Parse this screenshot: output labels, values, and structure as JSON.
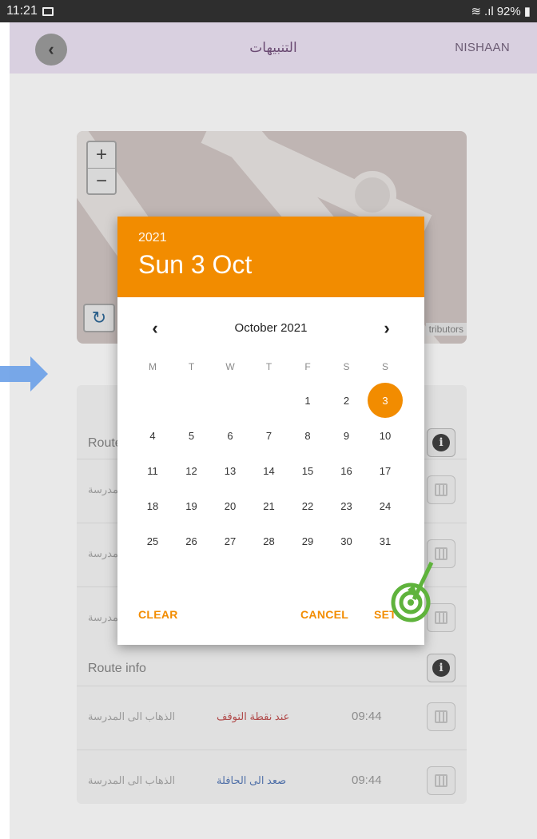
{
  "status_bar": {
    "time": "11:21",
    "battery": "92%"
  },
  "app": {
    "title": "التنبيهات",
    "user": "NISHAAN",
    "back_icon": "chevron-left-icon"
  },
  "map": {
    "zoom_in": "+",
    "zoom_out": "−",
    "attribution": "tributors"
  },
  "route_list": {
    "sections": [
      {
        "label": "Route info",
        "rows": [
          {
            "a": "الذهاب الى المدرسة",
            "b": "",
            "t": ""
          },
          {
            "a": "الذهاب الى المدرسة",
            "b": "",
            "t": ""
          },
          {
            "a": "الذهاب الى المدرسة",
            "b": "",
            "t": ""
          }
        ]
      },
      {
        "label": "Route info",
        "rows": [
          {
            "a": "الذهاب الى المدرسة",
            "b": "عند نقطة التوقف",
            "t": "09:44",
            "b_color": "red"
          },
          {
            "a": "الذهاب الى المدرسة",
            "b": "صعد الى الحافلة",
            "t": "09:44",
            "b_color": "blue"
          }
        ]
      }
    ]
  },
  "date_picker": {
    "year": "2021",
    "selected_label": "Sun 3 Oct",
    "month_label": "October 2021",
    "weekdays": [
      "M",
      "T",
      "W",
      "T",
      "F",
      "S",
      "S"
    ],
    "first_weekday_index": 4,
    "days_in_month": 31,
    "selected_day": 3,
    "buttons": {
      "clear": "CLEAR",
      "cancel": "CANCEL",
      "set": "SET"
    },
    "accent_color": "#f28c00"
  }
}
